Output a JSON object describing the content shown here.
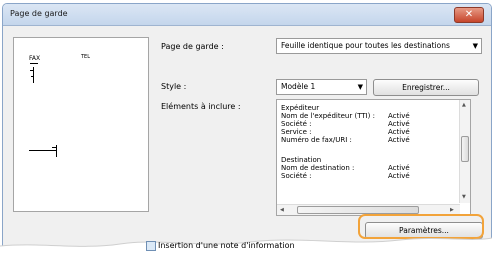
{
  "window": {
    "title": "Page de garde",
    "close_glyph": "✕"
  },
  "preview": {
    "fa_label": "FAX",
    "tel_label": "TEL"
  },
  "cover_page": {
    "label": "Page de garde :",
    "value": "Feuille identique pour toutes les destinations"
  },
  "style": {
    "label": "Style :",
    "value": "Modèle 1",
    "register_button": "Enregistrer..."
  },
  "elements": {
    "label": "Eléments à inclure :",
    "groups": [
      {
        "header": "Expéditeur",
        "rows": [
          {
            "name": "Nom de l'expéditeur (TTI) :",
            "value": "Activé"
          },
          {
            "name": "Société :",
            "value": "Activé"
          },
          {
            "name": "Service :",
            "value": "Activé"
          },
          {
            "name": "Numéro de fax/URI :",
            "value": "Activé"
          }
        ]
      },
      {
        "header": "Destination",
        "rows": [
          {
            "name": "Nom de destination :",
            "value": "Activé"
          },
          {
            "name": "Société :",
            "value": "Activé"
          }
        ]
      }
    ]
  },
  "settings_button": "Paramètres...",
  "insert_note": {
    "label": "Insertion d'une note d'information"
  }
}
